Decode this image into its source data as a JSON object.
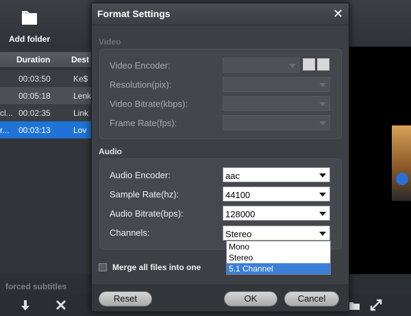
{
  "toolbar": {
    "add_folder_label": "Add folder"
  },
  "file_list": {
    "columns": {
      "duration": "Duration",
      "destination": "Dest"
    },
    "rows": [
      {
        "name": "",
        "duration": "00:03:50",
        "destination": "Ke$"
      },
      {
        "name": "",
        "duration": "00:05:18",
        "destination": "Lenk"
      },
      {
        "name": "cl...",
        "duration": "00:02:35",
        "destination": "Link"
      },
      {
        "name": "r...",
        "duration": "00:03:13",
        "destination": "Lov"
      }
    ]
  },
  "bottom": {
    "forced_subtitles_label": "forced subtitles"
  },
  "dialog": {
    "title": "Format Settings",
    "video": {
      "section_label": "Video",
      "encoder_label": "Video Encoder:",
      "resolution_label": "Resolution(pix):",
      "bitrate_label": "Video Bitrate(kbps):",
      "framerate_label": "Frame Rate(fps):"
    },
    "audio": {
      "section_label": "Audio",
      "encoder_label": "Audio Encoder:",
      "encoder_value": "aac",
      "sample_rate_label": "Sample Rate(hz):",
      "sample_rate_value": "44100",
      "bitrate_label": "Audio Bitrate(bps):",
      "bitrate_value": "128000",
      "channels_label": "Channels:",
      "channels_value": "Stereo",
      "channels_options": [
        "Mono",
        "Stereo",
        "5.1 Channel"
      ],
      "channels_highlighted": "5.1 Channel"
    },
    "merge_label": "Merge all files into one",
    "merge_checked": false,
    "buttons": {
      "reset": "Reset",
      "ok": "OK",
      "cancel": "Cancel"
    }
  },
  "colors": {
    "selection": "#1f73d6",
    "dropdown_highlight": "#3b7fd6"
  }
}
